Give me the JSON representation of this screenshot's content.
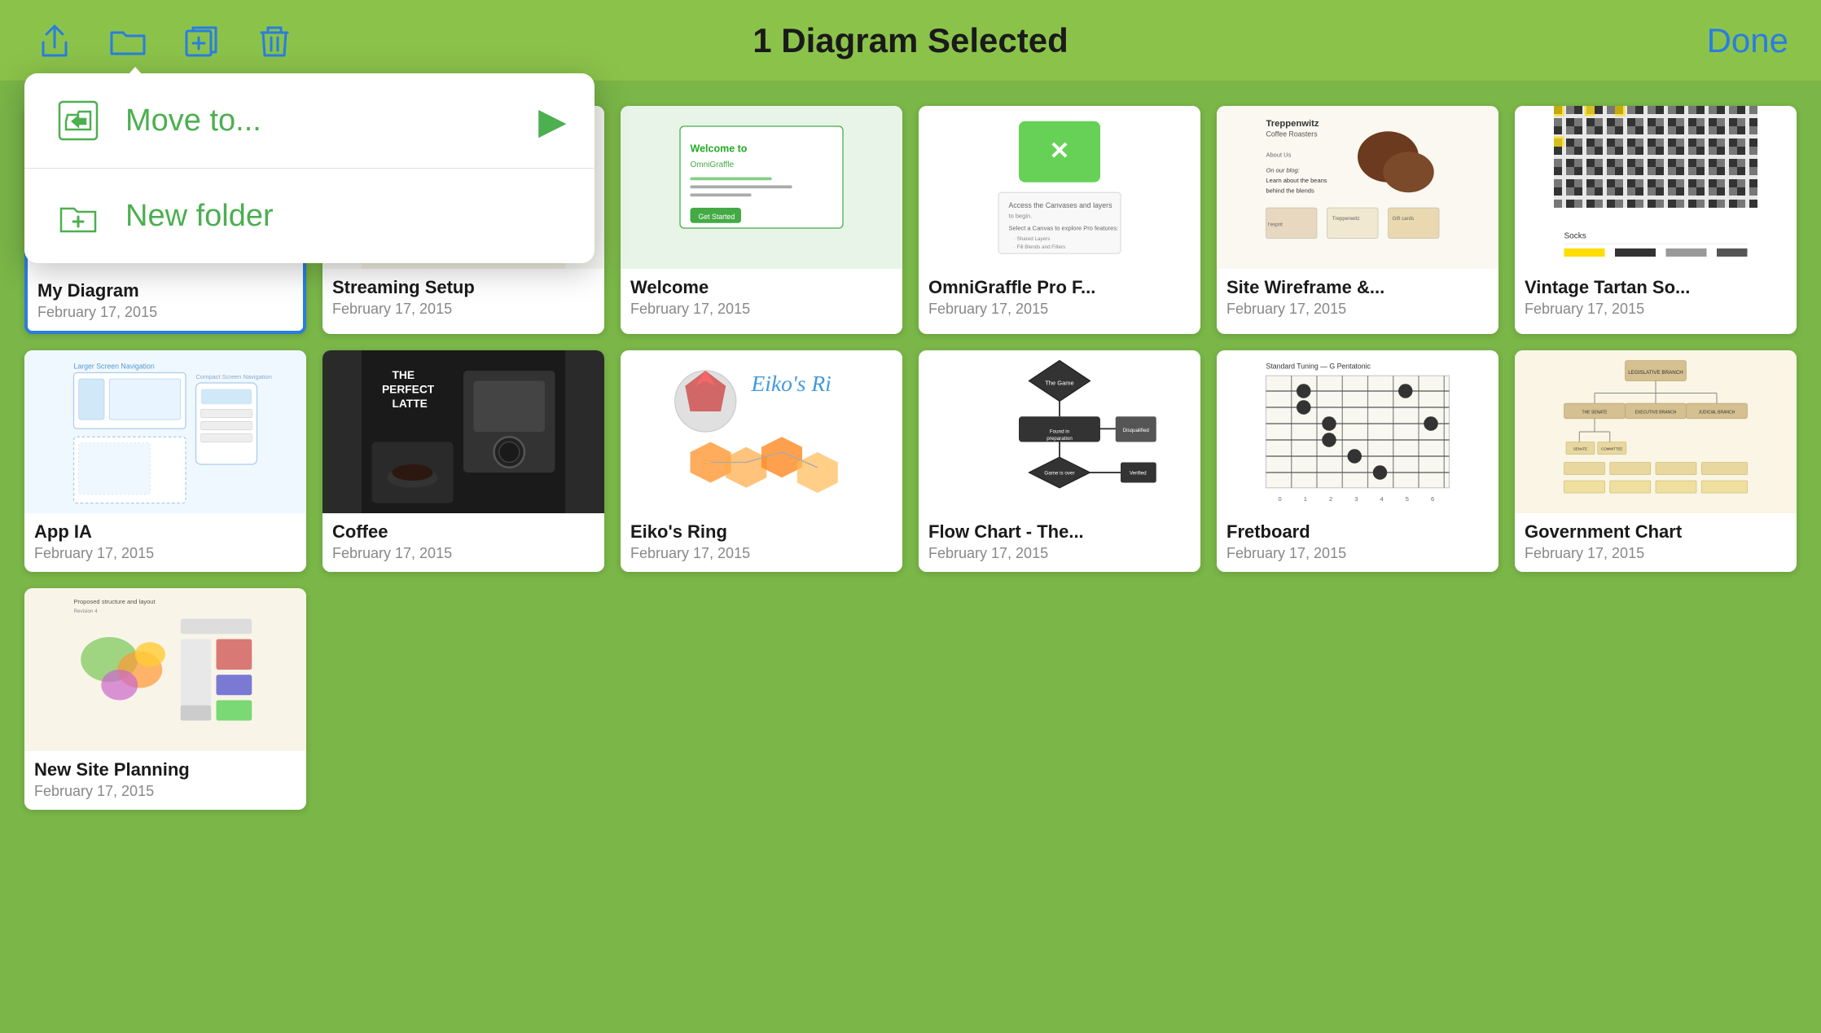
{
  "toolbar": {
    "title": "1 Diagram Selected",
    "done_label": "Done"
  },
  "dropdown": {
    "move_to_label": "Move to...",
    "new_folder_label": "New folder"
  },
  "diagrams": [
    {
      "id": "my-diagram",
      "name": "My Diagram",
      "date": "February 17, 2015",
      "selected": true,
      "thumb_type": "my-diagram"
    },
    {
      "id": "streaming-setup",
      "name": "Streaming Setup",
      "date": "February 17, 2015",
      "selected": false,
      "thumb_type": "streaming"
    },
    {
      "id": "welcome",
      "name": "Welcome",
      "date": "February 17, 2015",
      "selected": false,
      "thumb_type": "welcome"
    },
    {
      "id": "omnigraffle-pro",
      "name": "OmniGraffle Pro F...",
      "date": "February 17, 2015",
      "selected": false,
      "thumb_type": "omnigraffle"
    },
    {
      "id": "site-wireframe",
      "name": "Site Wireframe &...",
      "date": "February 17, 2015",
      "selected": false,
      "thumb_type": "wireframe"
    },
    {
      "id": "vintage-tartan",
      "name": "Vintage Tartan So...",
      "date": "February 17, 2015",
      "selected": false,
      "thumb_type": "tartan"
    },
    {
      "id": "app-ia",
      "name": "App IA",
      "date": "February 17, 2015",
      "selected": false,
      "thumb_type": "app-ia"
    },
    {
      "id": "coffee",
      "name": "Coffee",
      "date": "February 17, 2015",
      "selected": false,
      "thumb_type": "coffee"
    },
    {
      "id": "eikos-ring",
      "name": "Eiko's Ring",
      "date": "February 17, 2015",
      "selected": false,
      "thumb_type": "eiko"
    },
    {
      "id": "flow-chart",
      "name": "Flow Chart - The...",
      "date": "February 17, 2015",
      "selected": false,
      "thumb_type": "flowchart"
    },
    {
      "id": "fretboard",
      "name": "Fretboard",
      "date": "February 17, 2015",
      "selected": false,
      "thumb_type": "fretboard"
    },
    {
      "id": "government-chart",
      "name": "Government Chart",
      "date": "February 17, 2015",
      "selected": false,
      "thumb_type": "government"
    },
    {
      "id": "new-site-planning",
      "name": "New Site Planning",
      "date": "February 17, 2015",
      "selected": false,
      "thumb_type": "site-planning"
    }
  ]
}
